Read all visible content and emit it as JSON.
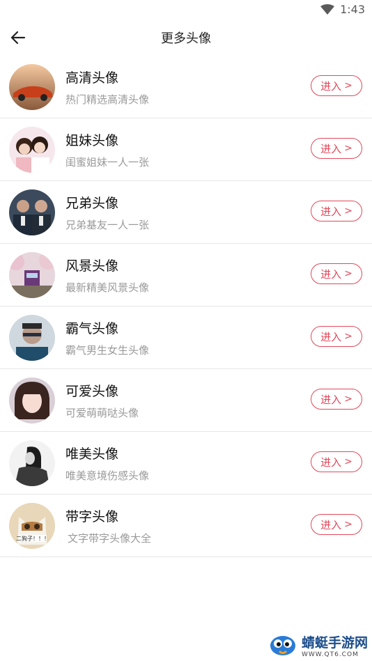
{
  "status": {
    "time": "1:43"
  },
  "header": {
    "title": "更多头像"
  },
  "items": [
    {
      "title": "高清头像",
      "subtitle": "热门精选高清头像",
      "button": "进入",
      "avatar": "car-photo"
    },
    {
      "title": "姐妹头像",
      "subtitle": "闺蜜姐妹一人一张",
      "button": "进入",
      "avatar": "two-girls-photo"
    },
    {
      "title": "兄弟头像",
      "subtitle": "兄弟基友一人一张",
      "button": "进入",
      "avatar": "two-men-photo"
    },
    {
      "title": "风景头像",
      "subtitle": "最新精美风景头像",
      "button": "进入",
      "avatar": "cherry-train-photo"
    },
    {
      "title": "霸气头像",
      "subtitle": "霸气男生女生头像",
      "button": "进入",
      "avatar": "cool-man-photo"
    },
    {
      "title": "可爱头像",
      "subtitle": "可爱萌萌哒头像",
      "button": "进入",
      "avatar": "cute-girl-photo"
    },
    {
      "title": "唯美头像",
      "subtitle": "唯美意境伤感头像",
      "button": "进入",
      "avatar": "bw-girl-photo"
    },
    {
      "title": "带字头像",
      "subtitle": "文字带字头像大全",
      "button": "进入",
      "avatar": "cat-text-photo",
      "avatar_caption": "二狗子！！！"
    }
  ],
  "watermark": {
    "name": "蜻蜓手游网",
    "url": "WWW.QT6.COM"
  },
  "colors": {
    "accent": "#e2485a",
    "title": "#111111",
    "subtitle": "#9a9a9a",
    "divider": "#e6e6e6"
  }
}
